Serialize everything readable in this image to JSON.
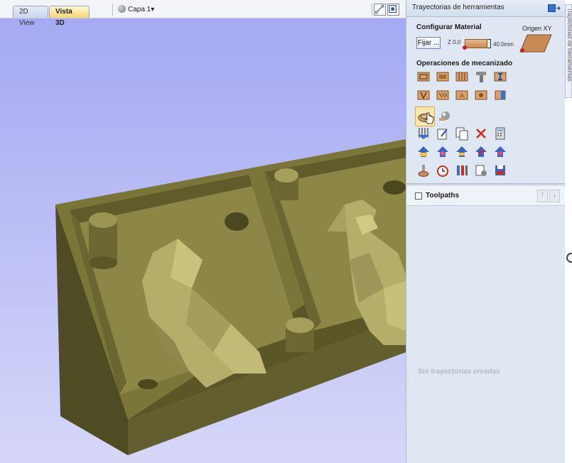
{
  "viewport": {
    "tabs": [
      {
        "label": "2D View",
        "active": false
      },
      {
        "label": "Vista 3D",
        "active": true
      }
    ],
    "layer": {
      "icon": "layer-sphere-icon",
      "label": "Capa 1",
      "dropdown": "▾"
    },
    "toolbar_right": [
      "node-edit-icon",
      "view-fit-icon"
    ],
    "background_gradient": [
      "#a3a8f2",
      "#d6d7f8"
    ],
    "model_color": "#6e6a34"
  },
  "panel": {
    "title": "Trayectorias de herramientas",
    "pin_icon": "dock-pin-icon",
    "config": {
      "title": "Configurar Material",
      "set_button": "Fijar ...",
      "z_zero": "Z 0.0",
      "thickness": "40.0mm",
      "origin_label": "Origen XY"
    },
    "operations": {
      "title": "Operaciones de mecanizado",
      "rows": [
        [
          "profile-toolpath-icon",
          "pocket-toolpath-icon",
          "drilling-toolpath-icon",
          "quick-engraving-icon",
          "inlay-toolpath-icon"
        ],
        [
          "v-carve-icon",
          "fluting-toolpath-icon",
          "prism-carve-icon",
          "texture-toolpath-icon",
          "moulding-toolpath-icon"
        ],
        [
          "roughing-3d-icon",
          "finishing-3d-icon"
        ],
        [
          "toolpath-summary-icon",
          "edit-toolpath-icon",
          "copy-toolpath-icon",
          "delete-toolpath-icon",
          "toolpath-calculator-icon"
        ],
        [
          "preview-all-icon",
          "preview-selected-icon",
          "reset-preview-icon",
          "animate-preview-icon",
          "toolpath-template-icon"
        ],
        [
          "tool-database-icon",
          "time-estimate-icon",
          "material-setup-icon",
          "merge-toolpath-icon",
          "save-toolpath-icon"
        ]
      ],
      "selected": "roughing-3d-icon"
    },
    "toolpaths": {
      "label": "Toolpaths",
      "checked": false,
      "move_up": "⇡",
      "move_down": "⇣",
      "empty_message": "Sin trayectorias creadas"
    }
  },
  "side_tab": {
    "label": "Trayectorias de herramientas"
  },
  "colors": {
    "panel_bg": "#dfe7f2",
    "accent_orange": "#e0a93a",
    "wood": "#c98a55",
    "model": "#6e6a34"
  }
}
